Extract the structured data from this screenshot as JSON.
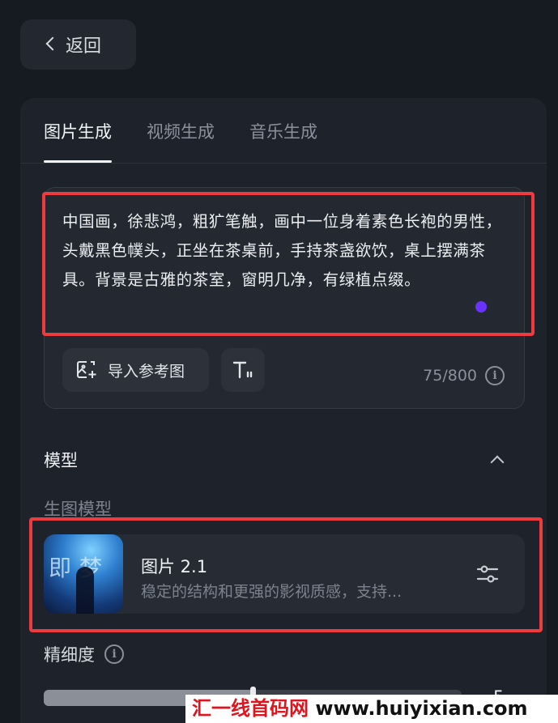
{
  "header": {
    "back_label": "返回"
  },
  "tabs": [
    {
      "label": "图片生成",
      "active": true
    },
    {
      "label": "视频生成",
      "active": false
    },
    {
      "label": "音乐生成",
      "active": false
    }
  ],
  "prompt": {
    "text": "中国画，徐悲鸿，粗犷笔触，画中一位身着素色长袍的男性，头戴黑色幞头，正坐在茶桌前，手持茶盏欲饮，桌上摆满茶具。背景是古雅的茶室，窗明几净，有绿植点缀。",
    "char_count": "75/800",
    "import_ref_label": "导入参考图"
  },
  "model_section": {
    "title": "模型",
    "subtitle": "生图模型",
    "model": {
      "thumb_glyphs": "即梦",
      "name": "图片 2.1",
      "description": "稳定的结构和更强的影视质感，支持..."
    }
  },
  "fineness": {
    "label": "精细度",
    "value": "5",
    "fill_fraction": 0.5
  },
  "watermark": {
    "prefix": "汇一线首码网",
    "url": "www.huiyixian.com"
  },
  "colors": {
    "background": "#161a21",
    "panel": "#1e232b",
    "highlight_box": "#ee3b3f",
    "caret": "#6a32ff"
  }
}
